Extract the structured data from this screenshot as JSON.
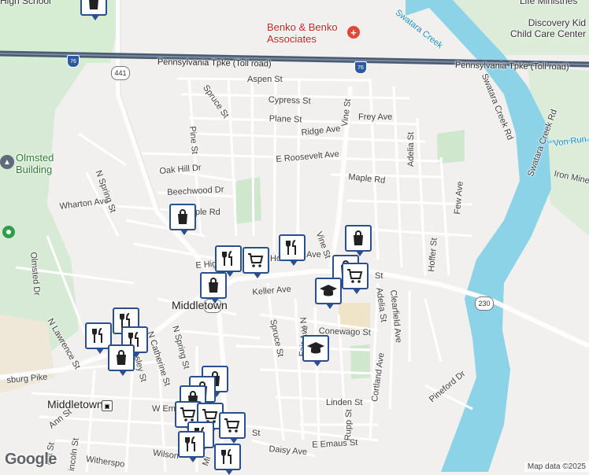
{
  "labels": {
    "poi_benko": "Benko & Benko\nAssociates",
    "poi_olmsted": "Olmsted\nBuilding",
    "poi_discovery": "Discovery Kid\nChild Care Center",
    "poi_life": "Life Ministries",
    "poi_high": "High School",
    "middletown_big": "Middletown",
    "middletown_station": "Middletown",
    "turnpike_left": "Pennsylvania Tpke (Toll road)",
    "turnpike_right": "Pennsylvania Tpke (Toll road)",
    "swatara_creek": "Swatara Creek",
    "swatara_creek_rd": "Swatara Creek Rd",
    "swatara_creek_rd2": "Swatara Creek Rd",
    "von_run": "Von Run",
    "iron_mine": "Iron Mine",
    "aspen": "Aspen St",
    "spruce_top": "Spruce St",
    "cypress": "Cypress St",
    "plane": "Plane St",
    "frey": "Frey Ave",
    "ridge": "Ridge Ave",
    "vine_top": "Vine St",
    "adelia_top": "Adelia St",
    "pine": "Pine St",
    "roosevelt": "E Roosevelt Ave",
    "maple": "Maple Rd",
    "oak_hill": "Oak Hill Dr",
    "beechwood": "Beechwood Dr",
    "wharton": "Wharton Ave",
    "n_spring_top": "N Spring St",
    "olmsted_dr": "Olmsted Dr",
    "few": "Few Ave",
    "hoffer": "Hoffer St",
    "vine_mid": "Vine St",
    "e_high": "E High",
    "ho_ave": "Ho",
    "ave_frag": "Ave",
    "st_frag": "St",
    "ple_rd": "ple Rd",
    "keller": "Keller Ave",
    "adelia_bot": "Adelia St",
    "clearfield": "Clearfield Ave",
    "n_lawrence": "N Lawrence St",
    "n_catherine": "N Catherine St",
    "n_spring_bot": "N Spring St",
    "asley": "asley St",
    "spruce_bot": "Spruce St",
    "n_r": "N R",
    "conewago": "Conewago St",
    "fair": "Fair Ave",
    "cortland": "Cortland Ave",
    "linden": "Linden St",
    "rupp": "Rupp St",
    "pineford": "Pineford Dr",
    "pike": "sburg Pike",
    "w_eman": "W Eman",
    "ann": "Ann St",
    "ant": "ant St",
    "lincoln": "incoln St",
    "withersp": "Witherspo",
    "wilson": "Wilson",
    "daisy": "Daisy Ave",
    "e_emaus": "E Emaus St",
    "st_daisy": "St",
    "mi": "Mi",
    "rt441_a": "441",
    "rt441_b": "441",
    "rt230": "230",
    "i76_a": "76",
    "i76_b": "76",
    "station_icon_glyph": "▣",
    "google": "Google",
    "attribution": "Map data ©2025"
  },
  "icons": [
    "shopping-bag-icon",
    "restaurant-icon",
    "grocery-cart-icon",
    "school-icon",
    "hospital-icon",
    "university-icon",
    "park-icon",
    "train-station-icon"
  ],
  "colors": {
    "water": "#8dd3e8",
    "park": "#c8e6c9",
    "road": "#ffffff",
    "turnpike": "#4a5a70",
    "marker_border": "#2a4f8f",
    "hospital": "#e0483a"
  }
}
